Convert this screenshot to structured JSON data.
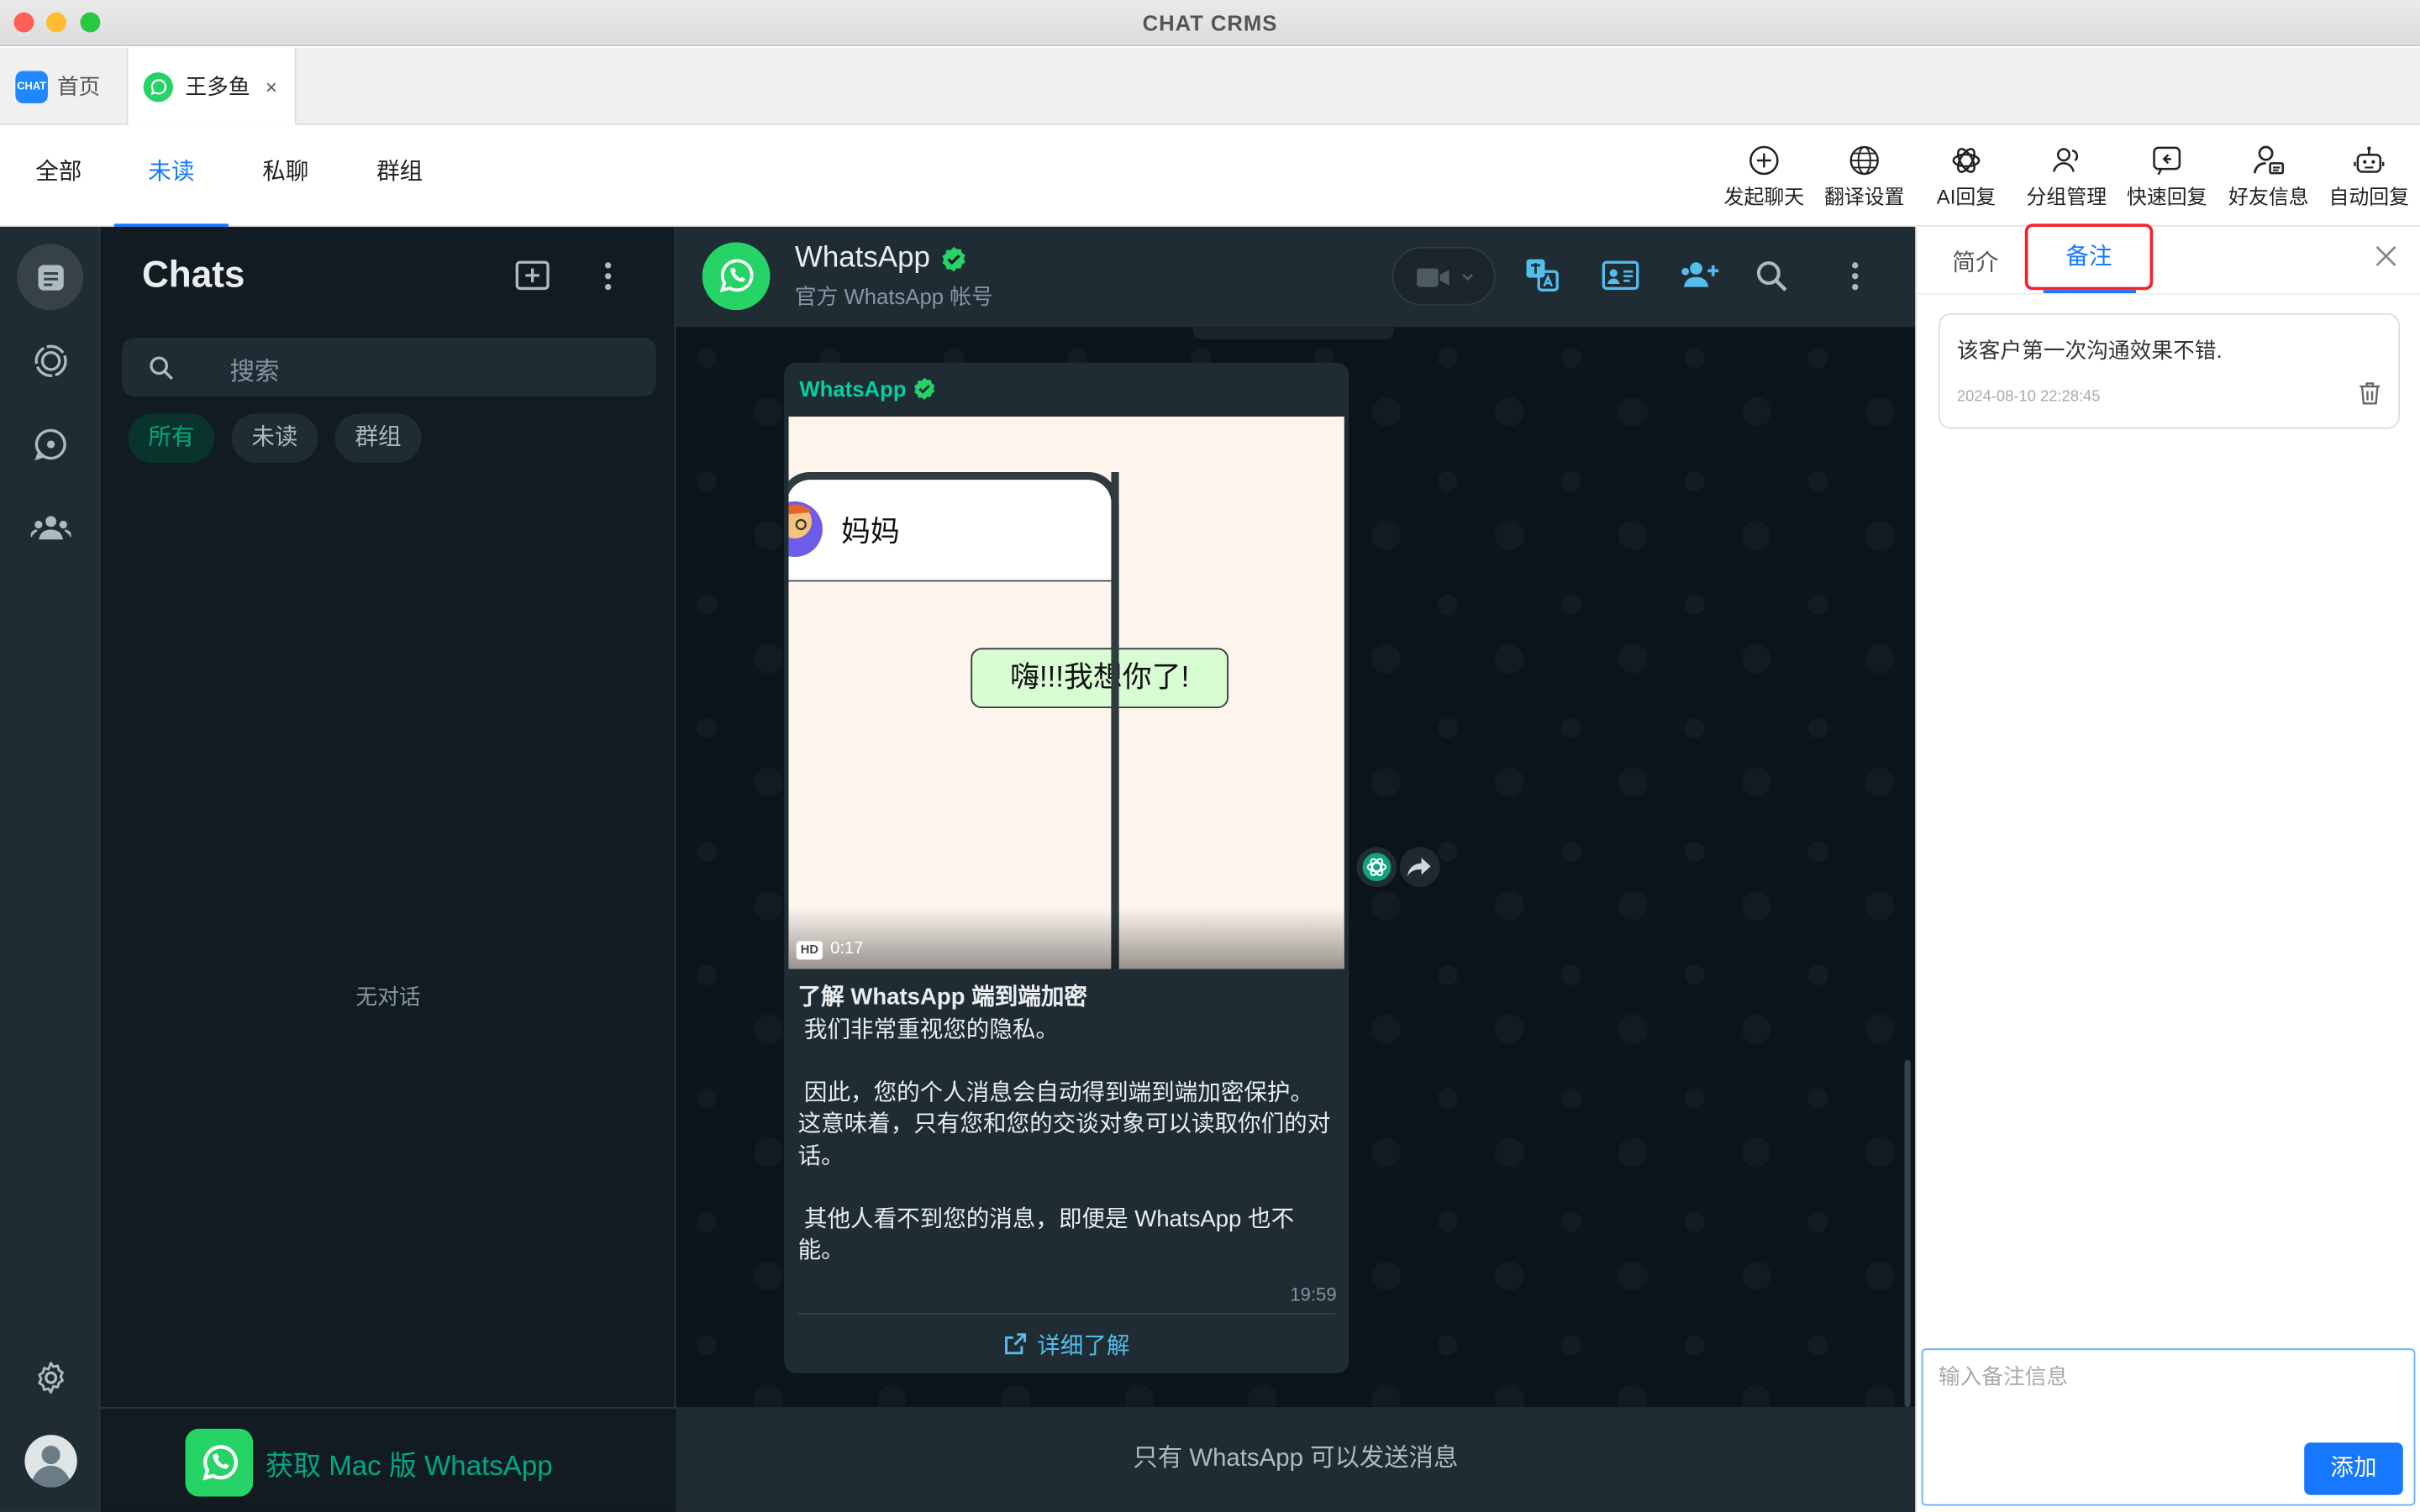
{
  "window": {
    "title": "CHAT CRMS"
  },
  "tabs": [
    {
      "label": "首页",
      "icon_text": "CHAT"
    },
    {
      "label": "王多鱼",
      "close": "×"
    }
  ],
  "filters": [
    "全部",
    "未读",
    "私聊",
    "群组"
  ],
  "active_filter": "未读",
  "tools": [
    "发起聊天",
    "翻译设置",
    "AI回复",
    "分组管理",
    "快速回复",
    "好友信息",
    "自动回复"
  ],
  "chat_list": {
    "title": "Chats",
    "search_placeholder": "搜索",
    "chips": [
      "所有",
      "未读",
      "群组"
    ],
    "empty": "无对话",
    "promo": "获取 Mac 版 WhatsApp"
  },
  "conversation": {
    "name": "WhatsApp",
    "subtitle": "官方 WhatsApp 帐号",
    "sender": "WhatsApp",
    "video": {
      "contact": "妈妈",
      "bubble": "嗨!!!我想你了!",
      "badge": "HD",
      "duration": "0:17"
    },
    "message_title": "了解 WhatsApp 端到端加密",
    "paragraphs": [
      "我们非常重视您的隐私。",
      "因此，您的个人消息会自动得到端到端加密保护。这意味着，只有您和您的交谈对象可以读取你们的对话。",
      "其他人看不到您的消息，即便是 WhatsApp 也不能。"
    ],
    "time": "19:59",
    "link": "详细了解",
    "footer": "只有 WhatsApp 可以发送消息"
  },
  "notes": {
    "tabs": [
      "简介",
      "备注"
    ],
    "active_tab": "备注",
    "items": [
      {
        "text": "该客户第一次沟通效果不错.",
        "time": "2024-08-10 22:28:45"
      }
    ],
    "input_placeholder": "输入备注信息",
    "add_label": "添加"
  },
  "colors": {
    "accent": "#1677ff",
    "whatsapp_green": "#25d366",
    "wa_teal": "#00a884",
    "highlight_box": "#f5222d"
  }
}
